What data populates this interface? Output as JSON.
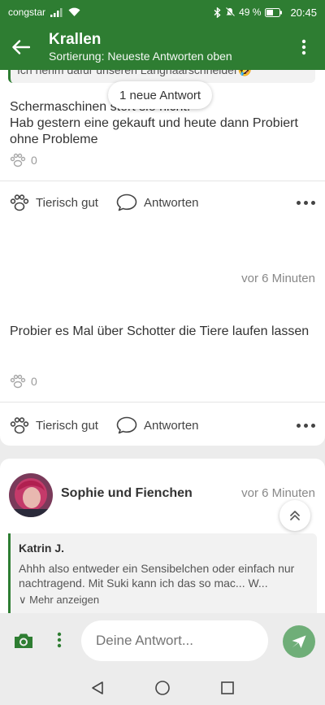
{
  "status_bar": {
    "carrier": "congstar",
    "battery_percent": "49 %",
    "time": "20:45"
  },
  "app_bar": {
    "title": "Krallen",
    "subtitle": "Sortierung: Neueste Antworten oben"
  },
  "new_replies_pill": "1 neue Antwort",
  "posts": [
    {
      "quote_peek": "Ich nehm dafür unseren Langhaarschneider🤣",
      "text": "Schermaschinen stört sie nicht.\nHab gestern eine gekauft und heute dann Probiert ohne Probleme",
      "likes": "0",
      "like_label": "Tierisch gut",
      "reply_label": "Antworten"
    },
    {
      "time": "vor 6 Minuten",
      "text": "Probier es Mal über Schotter die Tiere laufen lassen",
      "likes": "0",
      "like_label": "Tierisch gut",
      "reply_label": "Antworten"
    },
    {
      "author": "Sophie und Fienchen",
      "time": "vor 6 Minuten",
      "quote": {
        "author": "Katrin J.",
        "text": "Ahhh also entweder ein Sensibelchen oder einfach nur nachtragend. Mit Suki kann ich das so mac... W...",
        "more": "∨ Mehr anzeigen"
      }
    }
  ],
  "composer": {
    "placeholder": "Deine Antwort..."
  },
  "colors": {
    "brand_green": "#2e7d32",
    "send_green": "#6fae78"
  },
  "icons": [
    "back-arrow-icon",
    "more-vert-icon",
    "paw-icon",
    "comment-icon",
    "more-horiz-icon",
    "camera-icon",
    "send-icon",
    "chevron-up-double-icon",
    "nav-back-icon",
    "nav-home-icon",
    "nav-recents-icon"
  ]
}
